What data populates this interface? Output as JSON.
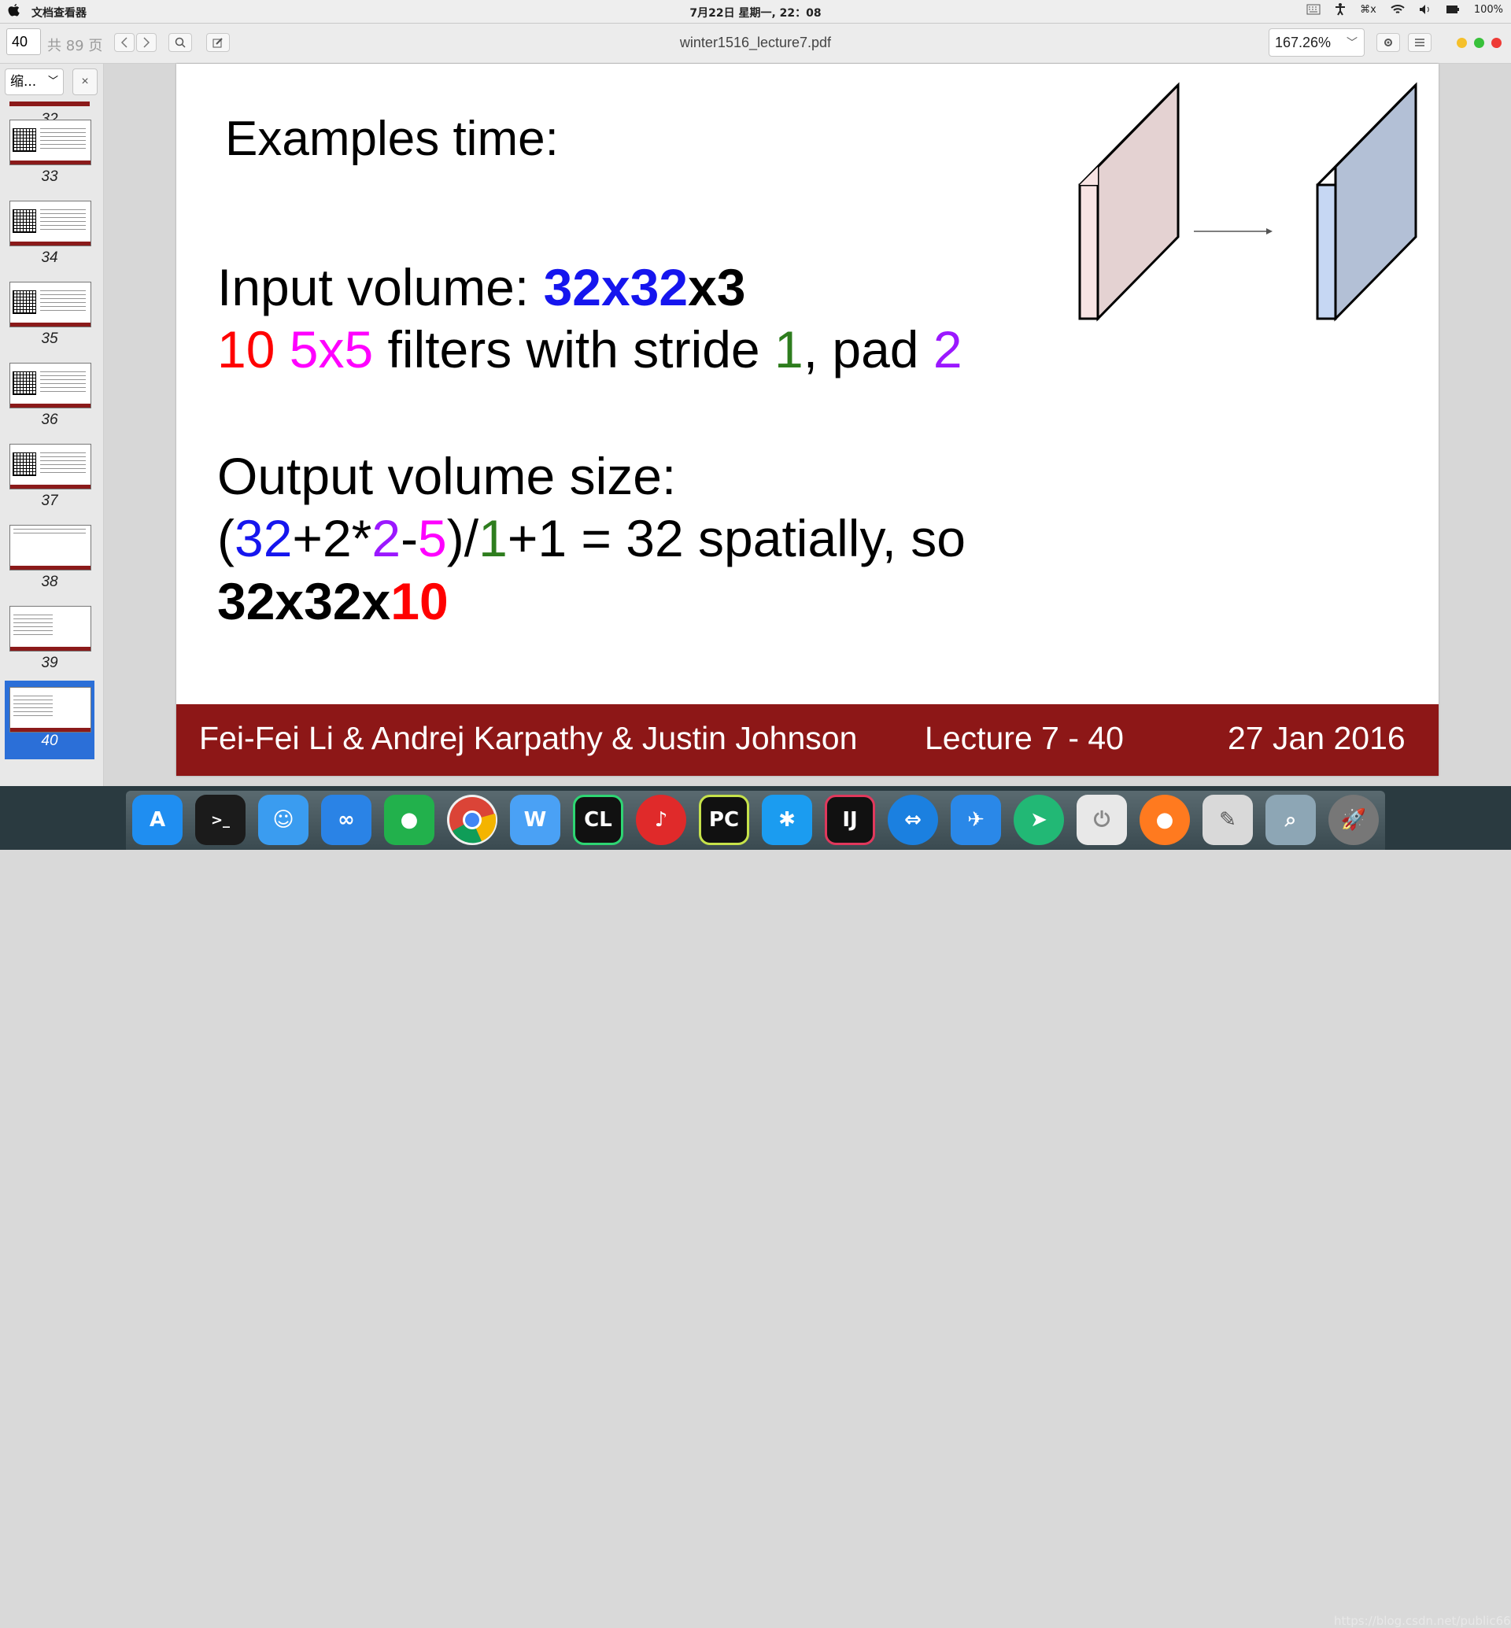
{
  "menubar": {
    "app_name": "文档查看器",
    "clock": "7月22日 星期一, 22：08",
    "status_items": [
      "⌘x",
      "100%"
    ]
  },
  "toolbar": {
    "page_number": "40",
    "page_total": "共 89 页",
    "document_title": "winter1516_lecture7.pdf",
    "zoom": "167.26%"
  },
  "sidebar": {
    "view_mode": "缩...",
    "close_label": "×",
    "thumbnails": [
      "32",
      "33",
      "34",
      "35",
      "36",
      "37",
      "38",
      "39",
      "40"
    ],
    "active_page": "40"
  },
  "slide": {
    "title": "Examples time:",
    "input_label": "Input volume: ",
    "input_spatial": "32x32",
    "input_depth": "x3",
    "filters_count": "10",
    "filters_size": "5x5",
    "filters_text": " filters with stride ",
    "stride": "1",
    "pad_text": ", pad ",
    "pad": "2",
    "output_label": "Output volume size:",
    "calc_open": "(",
    "calc_32": "32",
    "calc_plus2x": "+2*",
    "calc_2": "2",
    "calc_minus": "-",
    "calc_5": "5",
    "calc_div": ")/",
    "calc_1": "1",
    "calc_rest": "+1 = 32 spatially, so",
    "result_prefix": "32x32x",
    "result_depth": "10",
    "footer_authors": "Fei-Fei Li & Andrej Karpathy & Justin Johnson",
    "footer_lecture": "Lecture 7 - 40",
    "footer_date": "27 Jan 2016"
  },
  "dock": {
    "apps": [
      "app-store",
      "terminal",
      "finder",
      "baidu-netdisk",
      "wechat",
      "chrome",
      "wps",
      "clion",
      "netease-music",
      "pycharm",
      "xmind",
      "intellij",
      "teamviewer",
      "feishu",
      "telegram",
      "power",
      "firefox",
      "text-editor",
      "preview",
      "launcher"
    ]
  },
  "watermark": "https://blog.csdn.net/public669"
}
